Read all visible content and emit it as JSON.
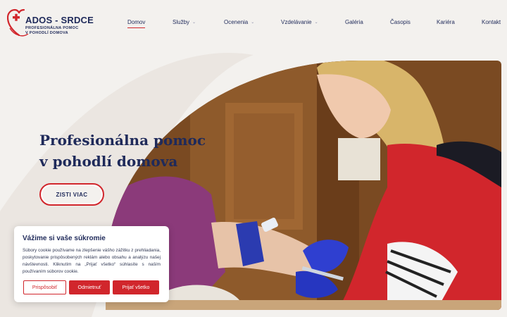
{
  "logo": {
    "name": "ADOS - SRDCE",
    "tagline_1": "PROFESIONÁLNA POMOC",
    "tagline_2": "V POHODLÍ DOMOVA"
  },
  "nav": [
    {
      "label": "Domov",
      "active": true,
      "dropdown": false
    },
    {
      "label": "Služby",
      "active": false,
      "dropdown": true
    },
    {
      "label": "Ocenenia",
      "active": false,
      "dropdown": true
    },
    {
      "label": "Vzdelávanie",
      "active": false,
      "dropdown": true
    },
    {
      "label": "Galéria",
      "active": false,
      "dropdown": false
    },
    {
      "label": "Časopis",
      "active": false,
      "dropdown": false
    },
    {
      "label": "Kariéra",
      "active": false,
      "dropdown": false
    },
    {
      "label": "Kontakt",
      "active": false,
      "dropdown": false
    }
  ],
  "hero": {
    "title_line1": "Profesionálna pomoc",
    "title_line2": "v pohodlí domova",
    "cta": "ZISTI VIAC"
  },
  "cookie": {
    "title": "Vážime si vaše súkromie",
    "text": "Súbory cookie používame na zlepšenie vášho zážitku z prehliadania, poskytovanie prispôsobených reklám alebo obsahu a analýzu našej návštevnosti. Kliknutím na „Prijať všetko“ súhlasíte s naším používaním súborov cookie.",
    "btn_customize": "Prispôsobiť",
    "btn_reject": "Odmietnuť",
    "btn_accept": "Prijať všetko"
  },
  "colors": {
    "brand_navy": "#1f2a5a",
    "brand_red": "#d1262c",
    "background": "#f3f1ee"
  }
}
